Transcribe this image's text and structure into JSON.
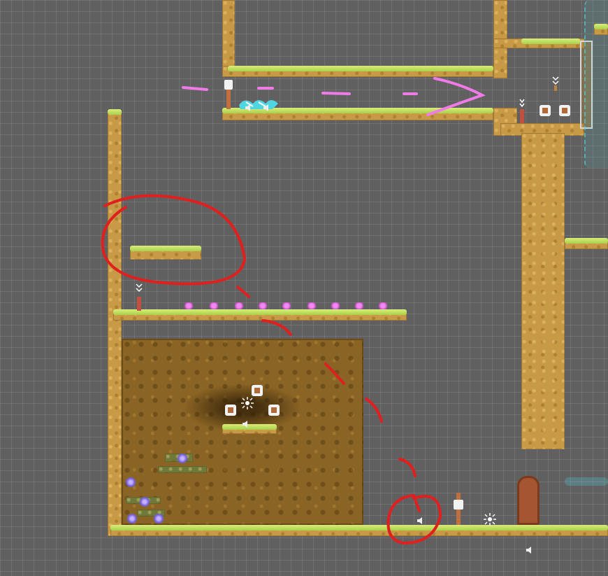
{
  "scene": {
    "background_color": "#606060",
    "grid_color": "#7a7a7a"
  },
  "colors": {
    "grass": "#b9dd5a",
    "dirt": "#c99a45",
    "soil": "#8a6424",
    "annotation_red": "#e01f1f",
    "annotation_pink": "#f07ae6",
    "crystal_pink": "#f08af0",
    "water_cyan": "#4fd6e0"
  },
  "icons": [
    "speaker-icon",
    "light-icon",
    "spawner-icon",
    "waypoint-icon",
    "door-icon",
    "crystal-icon",
    "fish-icon",
    "camera-boundary-icon"
  ]
}
